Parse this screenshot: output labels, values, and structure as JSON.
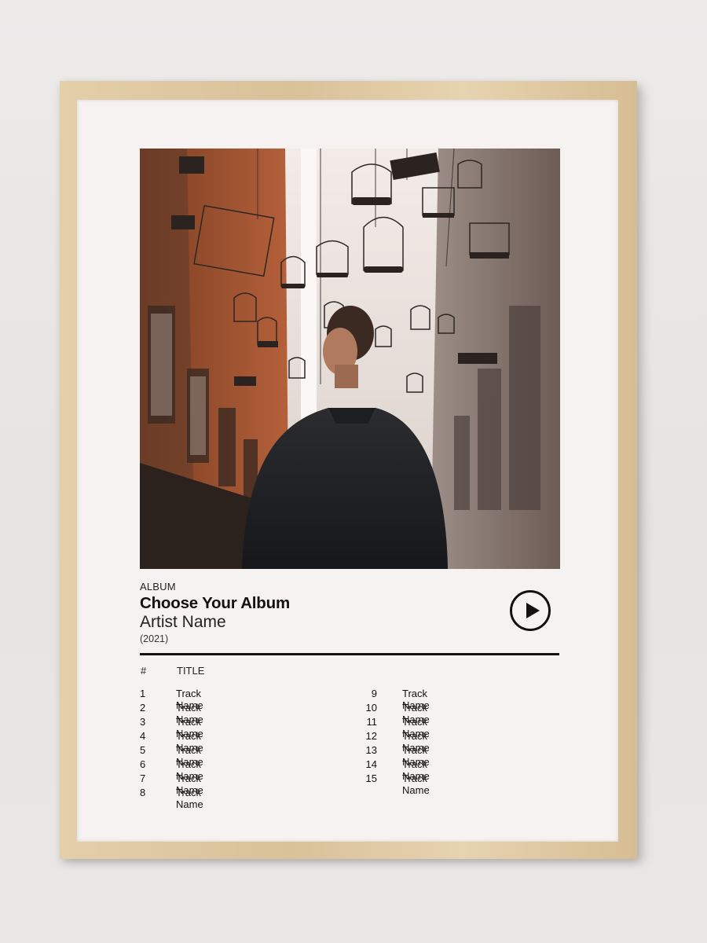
{
  "poster": {
    "label": "ALBUM",
    "album_title": "Choose Your Album",
    "artist": "Artist Name",
    "year": "(2021)"
  },
  "tracklist": {
    "header_number": "#",
    "header_title": "TITLE",
    "tracks": [
      {
        "num": "1",
        "name": "Track Name"
      },
      {
        "num": "2",
        "name": "Track Name"
      },
      {
        "num": "3",
        "name": "Track Name"
      },
      {
        "num": "4",
        "name": "Track Name"
      },
      {
        "num": "5",
        "name": "Track Name"
      },
      {
        "num": "6",
        "name": "Track Name"
      },
      {
        "num": "7",
        "name": "Track Name"
      },
      {
        "num": "8",
        "name": "Track Name"
      },
      {
        "num": "9",
        "name": "Track Name"
      },
      {
        "num": "10",
        "name": "Track Name"
      },
      {
        "num": "11",
        "name": "Track Name"
      },
      {
        "num": "12",
        "name": "Track Name"
      },
      {
        "num": "13",
        "name": "Track Name"
      },
      {
        "num": "14",
        "name": "Track Name"
      },
      {
        "num": "15",
        "name": "Track Name"
      }
    ]
  },
  "icons": {
    "play": "play-icon"
  },
  "colors": {
    "frame_wood": "#dcc49c",
    "paper": "#f5f2f1",
    "ink": "#111111"
  }
}
